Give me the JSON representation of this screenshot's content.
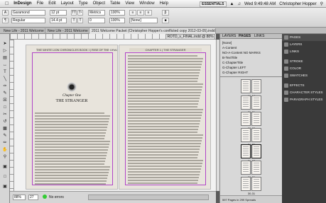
{
  "menubar": {
    "app": "InDesign",
    "items": [
      "File",
      "Edit",
      "Layout",
      "Type",
      "Object",
      "Table",
      "View",
      "Window",
      "Help"
    ],
    "workspace": "ESSENTIALS",
    "clock": "Wed 9:49:48 AM",
    "user": "Christopher Hopper",
    "cs": "CS Live"
  },
  "control": {
    "font": "Garamond",
    "style": "Regular",
    "size": "12 pt",
    "leading": "14.4 pt",
    "tracking": "0",
    "kerning": "Metrics",
    "scale_h": "100%",
    "scale_v": "100%",
    "swatch": "[None]"
  },
  "tabs": [
    "New Life - 2011 Welcome Packet.indd @ 72%",
    "New Life - 2011 Welcome Packet.indd @ 72%",
    "2011 Welcome Packet (Christopher Hopper's conflicted copy 2012-03-05).indd @ 100%"
  ],
  "document": {
    "title": "ROTD_v_FINAL.indd @ 88%",
    "left_header": "THE WHITE LION CHRONICLES BOOK I | RISE OF THE DRAGON",
    "right_header": "CHAPTER 1 | THE STRANGER",
    "chapter_label": "Chapter One",
    "chapter_title": "THE STRANGER",
    "zoom": "88%",
    "page": "27",
    "preflight": "No errors"
  },
  "pages_panel": {
    "tabs": [
      "LAYERS",
      "PAGES",
      "LINKS"
    ],
    "masters": [
      "[None]",
      "A-Content",
      "NO-A-Content NO MARKS",
      "B-TextTitle",
      "C-ChapterTitle",
      "G-Chapter LEFT",
      "G-Chapter RIGHT"
    ],
    "page_numbers": [
      "18-19",
      "20-21",
      "22-23",
      "24-25",
      "26-27",
      "28-29",
      "30-31"
    ],
    "footer": "597 Pages in 299 Spreads"
  },
  "dock": {
    "items": [
      "PAGES",
      "LAYERS",
      "LINKS",
      "STROKE",
      "COLOR",
      "SWATCHES",
      "EFFECTS",
      "CHARACTER STYLES",
      "PARAGRAPH STYLES"
    ]
  }
}
